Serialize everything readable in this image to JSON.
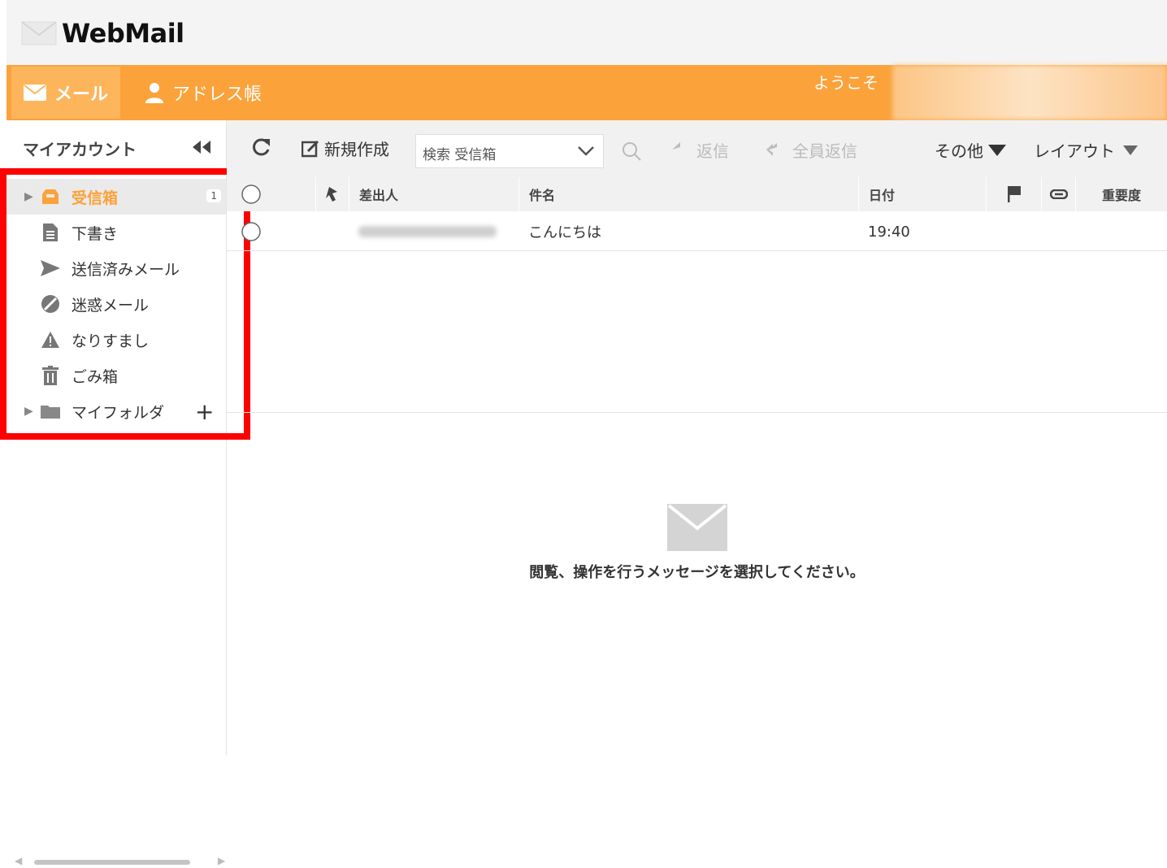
{
  "app": {
    "logo_text": "WebMail"
  },
  "nav": {
    "mail_label": "メール",
    "address_label": "アドレス帳",
    "welcome": "ようこそ"
  },
  "sidebar": {
    "header": "マイアカウント",
    "items": [
      {
        "label": "受信箱",
        "icon": "inbox-icon",
        "badge": "1",
        "active": true
      },
      {
        "label": "下書き",
        "icon": "draft-icon"
      },
      {
        "label": "送信済みメール",
        "icon": "send-icon"
      },
      {
        "label": "迷惑メール",
        "icon": "spam-icon"
      },
      {
        "label": "なりすまし",
        "icon": "warning-icon"
      },
      {
        "label": "ごみ箱",
        "icon": "trash-icon"
      },
      {
        "label": "マイフォルダ",
        "icon": "folder-icon"
      }
    ]
  },
  "toolbar": {
    "new_label": "新規作成",
    "search_placeholder": "検索 受信箱",
    "reply_label": "返信",
    "reply_all_label": "全員返信",
    "other_label": "その他",
    "layout_label": "レイアウト"
  },
  "table": {
    "headers": {
      "from": "差出人",
      "subject": "件名",
      "date": "日付",
      "priority": "重要度"
    },
    "rows": [
      {
        "subject": "こんにちは",
        "date": "19:40"
      }
    ]
  },
  "preview": {
    "empty_message": "閲覧、操作を行うメッセージを選択してください。"
  },
  "colors": {
    "accent": "#fba23a",
    "highlight": "#ff0000"
  }
}
